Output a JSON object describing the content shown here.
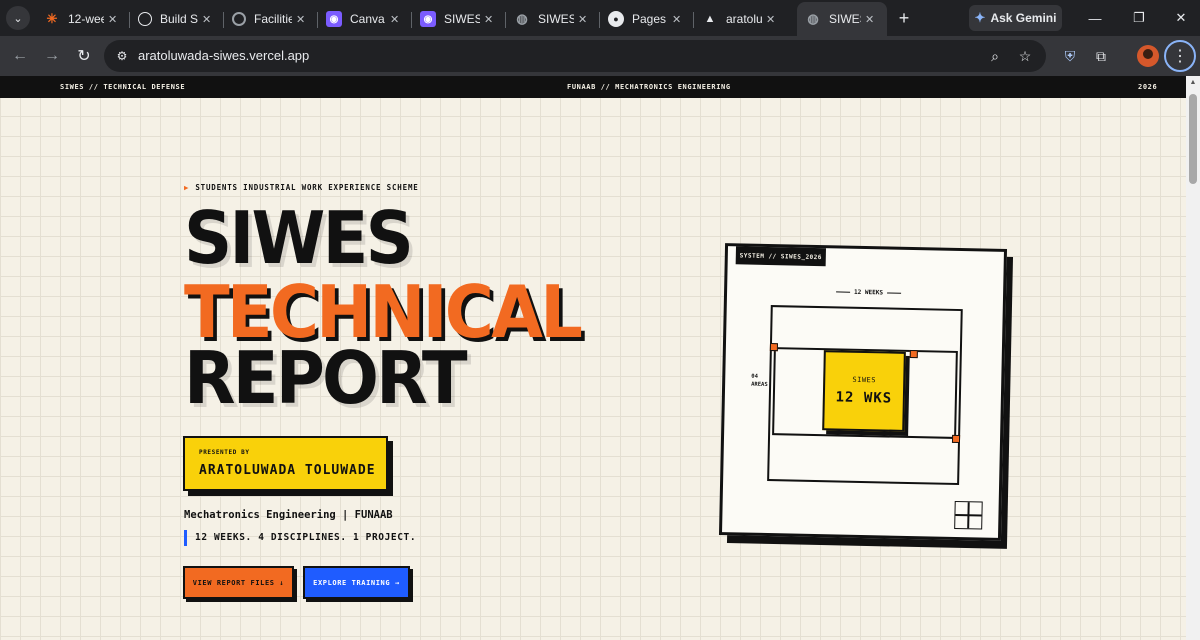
{
  "browser": {
    "tabs": [
      {
        "title": "12-wee",
        "icon": "spark-icon",
        "color": "#f26a21"
      },
      {
        "title": "Build S",
        "icon": "openai-icon",
        "color": "#ffffff"
      },
      {
        "title": "Facilitie",
        "icon": "spinner-icon",
        "color": "#9aa0a6"
      },
      {
        "title": "Canva",
        "icon": "canva-icon",
        "color": "#7b5cff"
      },
      {
        "title": "SIWES",
        "icon": "canva-icon",
        "color": "#7b5cff"
      },
      {
        "title": "SIWES",
        "icon": "globe-icon",
        "color": "#9aa0a6"
      },
      {
        "title": "Pages",
        "icon": "github-icon",
        "color": "#ffffff"
      },
      {
        "title": "aratolu",
        "icon": "vercel-icon",
        "color": "#ffffff"
      },
      {
        "title": "SIWES",
        "icon": "globe-icon",
        "color": "#9aa0a6",
        "active": true
      }
    ],
    "new_tab": "+",
    "gemini_label": "Ask Gemini",
    "url": "aratoluwada-siwes.vercel.app"
  },
  "site_bar": {
    "left": "SIWES // TECHNICAL DEFENSE",
    "center": "FUNAAB // MECHATRONICS ENGINEERING",
    "right": "2026"
  },
  "hero": {
    "eyebrow": "STUDENTS INDUSTRIAL WORK EXPERIENCE SCHEME",
    "line1": "SIWES",
    "line2": "TECHNICAL",
    "line3": "REPORT",
    "presented_by": "PRESENTED BY",
    "presenter_name": "ARATOLUWADA TOLUWADE",
    "department": "Mechatronics Engineering | FUNAAB",
    "tagline": "12 WEEKS. 4 DISCIPLINES. 1 PROJECT.",
    "cta_primary": "VIEW REPORT FILES ↓",
    "cta_secondary": "EXPLORE TRAINING →"
  },
  "card": {
    "system_tag": "SYSTEM // SIWES_2026",
    "weeks_dim": "12 WEEKS",
    "areas_num": "04",
    "areas_label": "AREAS",
    "box_label": "SIWES",
    "box_value": "12 WKS"
  },
  "colors": {
    "accent_orange": "#f26a21",
    "accent_yellow": "#f9d10a",
    "accent_blue": "#1f5cff",
    "ink": "#111111",
    "paper": "#f5f1e6"
  }
}
